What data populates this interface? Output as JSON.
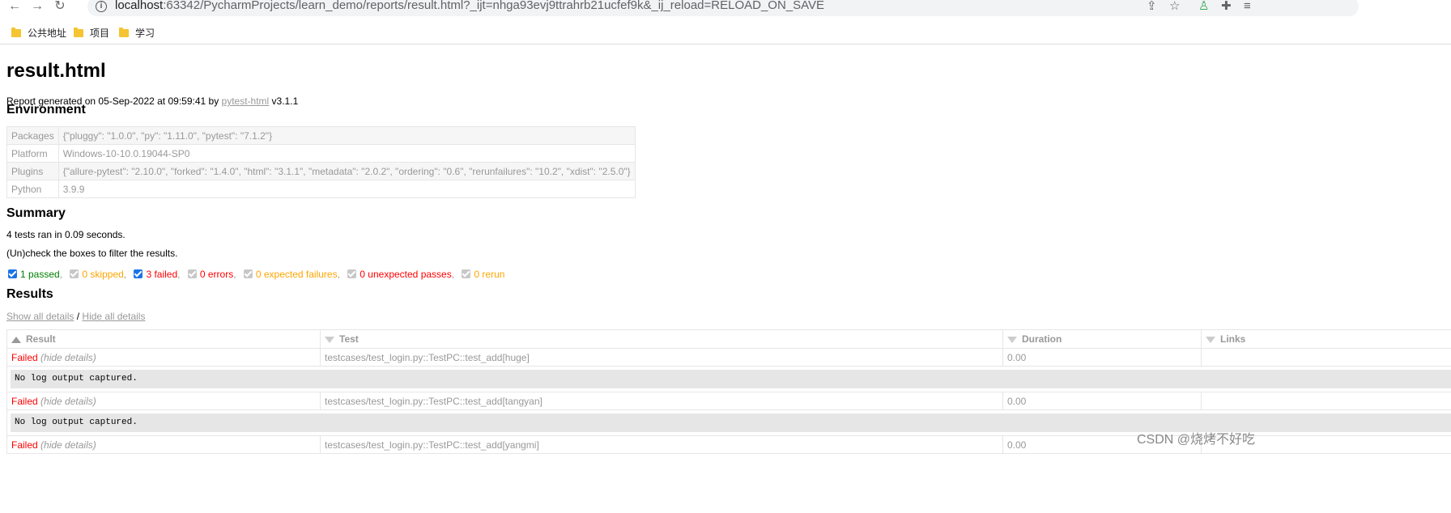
{
  "browser": {
    "url_host": "localhost",
    "url_rest": ":63342/PycharmProjects/learn_demo/reports/result.html?_ijt=nhga93evj9ttrahrb21ucfef9k&_ij_reload=RELOAD_ON_SAVE",
    "bookmarks": [
      "公共地址",
      "项目",
      "学习"
    ]
  },
  "report": {
    "title": "result.html",
    "gen_prefix": "Report generated on 05-Sep-2022 at 09:59:41 by ",
    "gen_link": "pytest-html",
    "gen_version": " v3.1.1"
  },
  "environment": {
    "heading": "Environment",
    "rows": [
      {
        "key": "Packages",
        "value": "{\"pluggy\": \"1.0.0\", \"py\": \"1.11.0\", \"pytest\": \"7.1.2\"}"
      },
      {
        "key": "Platform",
        "value": "Windows-10-10.0.19044-SP0"
      },
      {
        "key": "Plugins",
        "value": "{\"allure-pytest\": \"2.10.0\", \"forked\": \"1.4.0\", \"html\": \"3.1.1\", \"metadata\": \"2.0.2\", \"ordering\": \"0.6\", \"rerunfailures\": \"10.2\", \"xdist\": \"2.5.0\"}"
      },
      {
        "key": "Python",
        "value": "3.9.9"
      }
    ]
  },
  "summary": {
    "heading": "Summary",
    "ran": "4 tests ran in 0.09 seconds.",
    "hint": "(Un)check the boxes to filter the results.",
    "filters": [
      {
        "label": "1 passed",
        "checked": true
      },
      {
        "label": "0 skipped",
        "checked": false
      },
      {
        "label": "3 failed",
        "checked": true
      },
      {
        "label": "0 errors",
        "checked": false
      },
      {
        "label": "0 expected failures",
        "checked": false
      },
      {
        "label": "0 unexpected passes",
        "checked": false
      },
      {
        "label": "0 rerun",
        "checked": false
      }
    ]
  },
  "results": {
    "heading": "Results",
    "show_all": "Show all details",
    "slash": " / ",
    "hide_all": "Hide all details",
    "columns": [
      "Result",
      "Test",
      "Duration",
      "Links"
    ],
    "rows": [
      {
        "result": "Failed",
        "toggle": "(hide details)",
        "test": "testcases/test_login.py::TestPC::test_add[huge]",
        "duration": "0.00",
        "log": "No log output captured."
      },
      {
        "result": "Failed",
        "toggle": "(hide details)",
        "test": "testcases/test_login.py::TestPC::test_add[tangyan]",
        "duration": "0.00",
        "log": "No log output captured."
      },
      {
        "result": "Failed",
        "toggle": "(hide details)",
        "test": "testcases/test_login.py::TestPC::test_add[yangmi]",
        "duration": "0.00"
      }
    ]
  },
  "watermark": "CSDN @烧烤不好吃",
  "colors": {
    "passed": "#008000",
    "failed": "#ff0000",
    "skipped": "#ffa500",
    "muted": "#999999"
  }
}
